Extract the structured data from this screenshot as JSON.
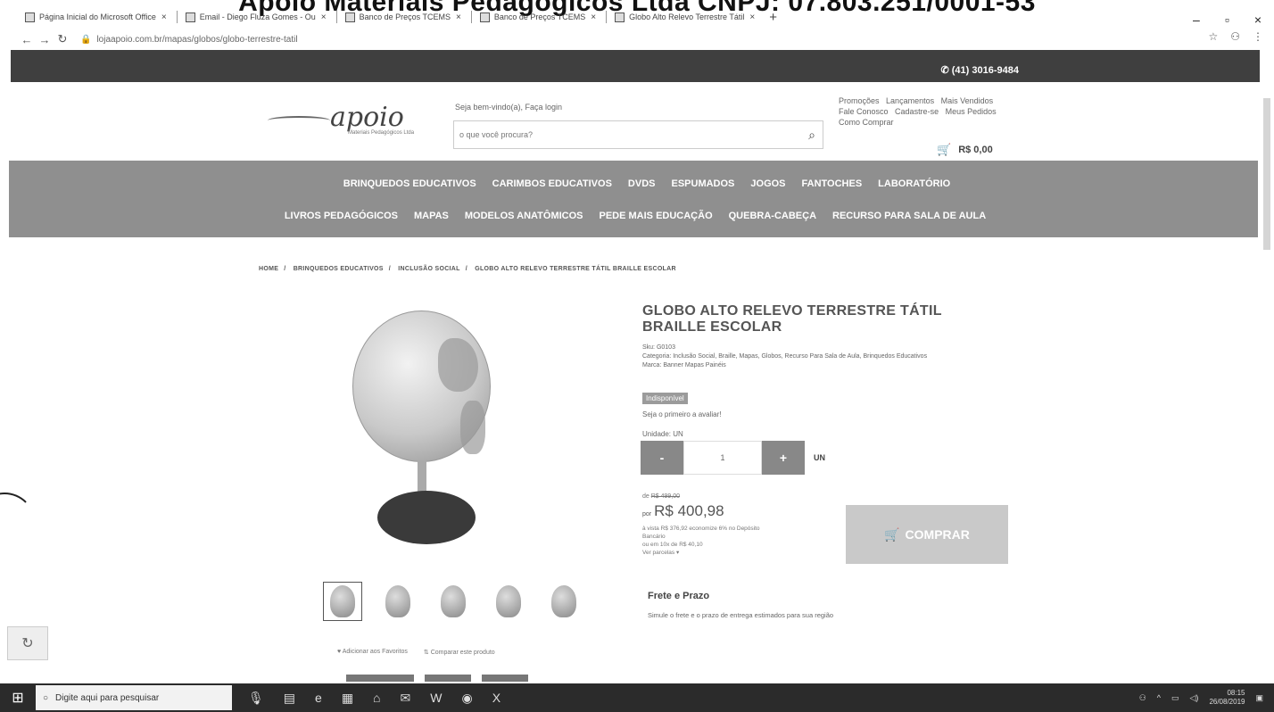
{
  "document_caption": "Apoio Materiais Pedagógicos Ltda   CNPJ: 07.803.251/0001-53",
  "browser": {
    "tabs": [
      {
        "label": "Página Inicial do Microsoft Office"
      },
      {
        "label": "Email - Diego Fluza Gomes - Ou"
      },
      {
        "label": "Banco de Preços TCEMS"
      },
      {
        "label": "Banco de Preços TCEMS"
      },
      {
        "label": "Globo Alto Relevo Terrestre Tátil"
      }
    ],
    "url": "lojaapoio.com.br/mapas/globos/globo-terrestre-tatil"
  },
  "topbar": {
    "phone": "(41) 3016-9484"
  },
  "header": {
    "logo_text": "apoio",
    "logo_sub": "Materiais Pedagógicos Ltda",
    "greeting": "Seja bem-vindo(a), Faça login",
    "search_placeholder": "o que você procura?",
    "links": [
      "Promoções",
      "Lançamentos",
      "Mais Vendidos",
      "Fale Conosco",
      "Cadastre-se",
      "Meus Pedidos",
      "Como Comprar"
    ],
    "cart_total": "R$ 0,00"
  },
  "categories": {
    "row1": [
      "BRINQUEDOS EDUCATIVOS",
      "CARIMBOS EDUCATIVOS",
      "DVDS",
      "ESPUMADOS",
      "JOGOS",
      "FANTOCHES",
      "LABORATÓRIO"
    ],
    "row2": [
      "LIVROS PEDAGÓGICOS",
      "MAPAS",
      "MODELOS ANATÔMICOS",
      "PEDE MAIS EDUCAÇÃO",
      "QUEBRA-CABEÇA",
      "RECURSO PARA SALA DE AULA"
    ]
  },
  "breadcrumb": [
    "HOME",
    "BRINQUEDOS EDUCATIVOS",
    "INCLUSÃO SOCIAL",
    "GLOBO ALTO RELEVO TERRESTRE TÁTIL BRAILLE ESCOLAR"
  ],
  "product": {
    "title": "GLOBO ALTO RELEVO TERRESTRE TÁTIL BRAILLE ESCOLAR",
    "sku": "Sku: G0103",
    "category": "Categoria: Inclusão Social, Braille, Mapas, Globos, Recurso Para Sala de Aula, Brinquedos Educativos",
    "brand": "Marca: Banner Mapas Painéis",
    "badge": "Indisponível",
    "rating_text": "Seja o primeiro a avaliar!",
    "unit_label": "Unidade: UN",
    "qty_minus": "-",
    "qty_value": "1",
    "qty_plus": "+",
    "qty_unit": "UN",
    "price_old_prefix": "de",
    "price_old": "R$ 499,00",
    "price_new_prefix": "por",
    "price_new": "R$ 400,98",
    "price_info_1": "à vista R$ 376,92 economize 6% no Depósito",
    "price_info_2": "Bancário",
    "price_info_3": "ou em 10x de R$ 40,10",
    "installments_link": "Ver parcelas",
    "buy_label": "COMPRAR",
    "fav_label": "Adicionar aos Favoritos",
    "compare_label": "Comparar este produto"
  },
  "shipping": {
    "title": "Frete e Prazo",
    "text": "Simule o frete e o prazo de entrega estimados para sua região"
  },
  "taskbar": {
    "search_placeholder": "Digite aqui para pesquisar",
    "time": "08:15",
    "date": "26/08/2019"
  }
}
